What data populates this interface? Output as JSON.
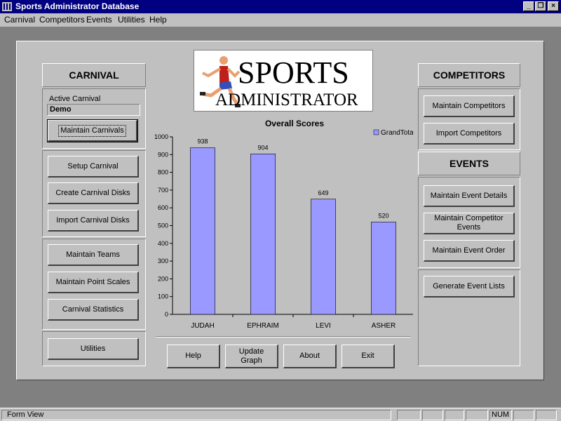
{
  "window": {
    "title": "Sports Administrator Database",
    "controls": {
      "minimize": "_",
      "restore": "❐",
      "close": "×"
    }
  },
  "menu": [
    "Carnival",
    "Competitors",
    "Events",
    "Utilities",
    "Help"
  ],
  "carnival": {
    "heading": "CARNIVAL",
    "active_label": "Active Carnival",
    "active_value": "Demo",
    "buttons": {
      "maintain_carnivals": "Maintain Carnivals",
      "setup_carnival": "Setup Carnival",
      "create_disks": "Create Carnival Disks",
      "import_disks": "Import Carnival Disks",
      "maintain_teams": "Maintain Teams",
      "maintain_point_scales": "Maintain Point Scales",
      "carnival_statistics": "Carnival Statistics",
      "utilities": "Utilities"
    }
  },
  "logo": {
    "line1": "SPORTS",
    "line2": "ADMINISTRATOR"
  },
  "competitors": {
    "heading": "COMPETITORS",
    "buttons": {
      "maintain_competitors": "Maintain Competitors",
      "import_competitors": "Import Competitors"
    }
  },
  "events": {
    "heading": "EVENTS",
    "buttons": {
      "maintain_event_details": "Maintain Event Details",
      "maintain_competitor_events": "Maintain Competitor Events",
      "maintain_event_order": "Maintain Event Order",
      "generate_event_lists": "Generate Event Lists"
    }
  },
  "bottom_buttons": {
    "help": "Help",
    "update_graph": "Update Graph",
    "about": "About",
    "exit": "Exit"
  },
  "chart_data": {
    "type": "bar",
    "title": "Overall Scores",
    "categories": [
      "JUDAH",
      "EPHRAIM",
      "LEVI",
      "ASHER"
    ],
    "series": [
      {
        "name": "GrandTotal",
        "values": [
          938,
          904,
          649,
          520
        ]
      }
    ],
    "ylim": [
      0,
      1000
    ],
    "yticks": [
      0,
      100,
      200,
      300,
      400,
      500,
      600,
      700,
      800,
      900,
      1000
    ],
    "legend": "top-right",
    "grid": false,
    "bar_color": "#9999ff"
  },
  "status": {
    "text": "Form View",
    "num": "NUM"
  }
}
